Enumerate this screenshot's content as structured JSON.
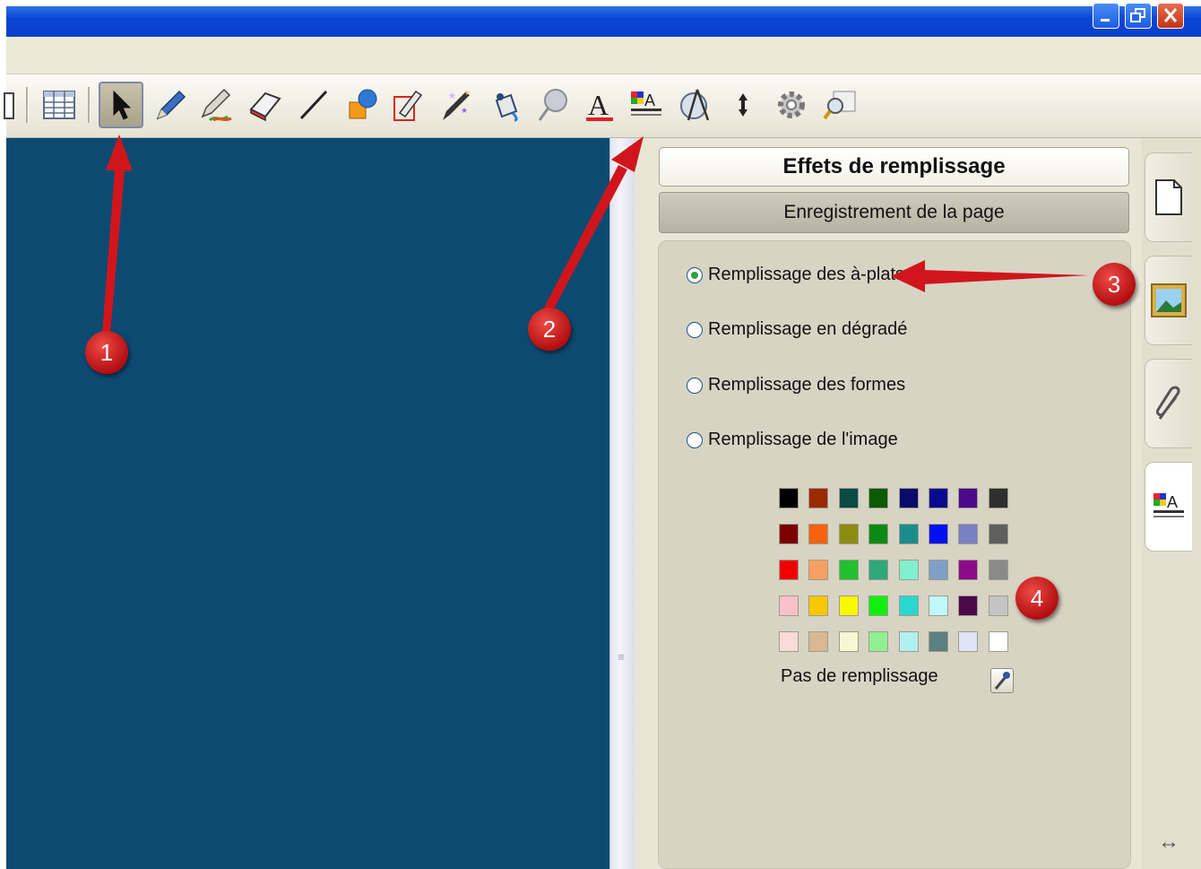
{
  "toolbar": {
    "tools": [
      "page-icon",
      "table-icon",
      "select-arrow-icon",
      "pen-icon",
      "creative-pen-icon",
      "eraser-icon",
      "line-icon",
      "shapes-icon",
      "magic-pen-icon",
      "sparkle-pen-icon",
      "fill-bucket-icon",
      "pushpin-icon",
      "text-icon",
      "fill-effects-icon",
      "compass-icon",
      "move-arrows-icon",
      "settings-gear-icon",
      "magnifier-icon"
    ]
  },
  "panel": {
    "title": "Effets de remplissage",
    "page_record_label": "Enregistrement de la page",
    "fill_options": [
      {
        "label": "Remplissage des à-plats",
        "selected": true
      },
      {
        "label": "Remplissage en dégradé",
        "selected": false
      },
      {
        "label": "Remplissage des formes",
        "selected": false
      },
      {
        "label": "Remplissage de l'image",
        "selected": false
      }
    ],
    "palette": [
      [
        "#000000",
        "#9a2a00",
        "#0c4a44",
        "#0a5a06",
        "#0a0a6a",
        "#0a0a8e",
        "#4a0a8a",
        "#2f2f2f"
      ],
      [
        "#7a0000",
        "#f7620e",
        "#8c8c10",
        "#0a8a12",
        "#1b8c8c",
        "#0010f0",
        "#7a80c4",
        "#5f5f5f"
      ],
      [
        "#f00000",
        "#f7a062",
        "#20c030",
        "#2ea87a",
        "#7ff0d0",
        "#7ea0c8",
        "#8a0a8a",
        "#8a8a8a"
      ],
      [
        "#f8c0c8",
        "#f7c800",
        "#f8f800",
        "#10f010",
        "#28d8d0",
        "#c0f8f8",
        "#4a0a4a",
        "#c4c4c4"
      ],
      [
        "#f8dcd8",
        "#d8b890",
        "#f8f8d0",
        "#90f090",
        "#b0f0f0",
        "#5a8080",
        "#e0e4f8",
        "#ffffff"
      ]
    ],
    "no_fill_label": "Pas de remplissage"
  },
  "side_tabs": [
    "page-sorter-icon",
    "gallery-image-icon",
    "attachments-paperclip-icon",
    "fill-effects-tab-icon"
  ],
  "annotations": [
    "1",
    "2",
    "3",
    "4"
  ],
  "colors": {
    "canvas": "#0d4a72",
    "annotation": "#d0161c",
    "titlebar": "#0a46d6"
  }
}
